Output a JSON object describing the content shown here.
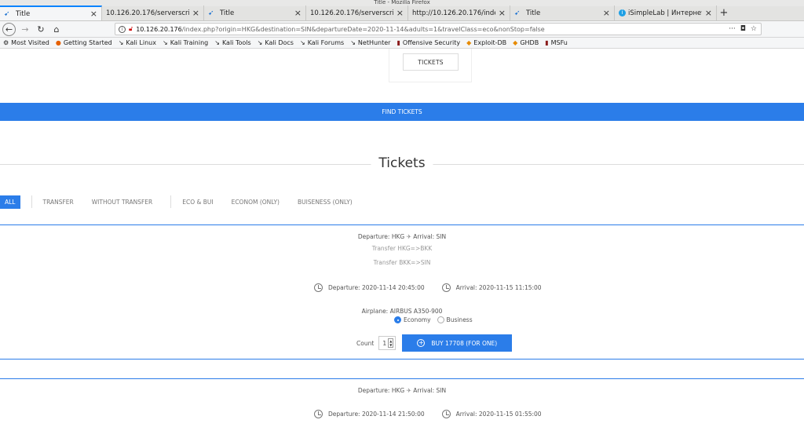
{
  "window": {
    "title": "Title - Mozilla Firefox"
  },
  "tabs": [
    {
      "label": "Title",
      "icon": "bird-icon",
      "active": true
    },
    {
      "label": "10.126.20.176/serverscript",
      "icon": "",
      "active": false
    },
    {
      "label": "Title",
      "icon": "bird-icon",
      "active": false
    },
    {
      "label": "10.126.20.176/serverscript",
      "icon": "",
      "active": false
    },
    {
      "label": "http://10.126.20.176/index.p",
      "icon": "",
      "active": false
    },
    {
      "label": "Title",
      "icon": "bird-icon",
      "active": false
    },
    {
      "label": "iSimpleLab | Интернет-",
      "icon": "info-icon",
      "active": false
    }
  ],
  "urlbar": {
    "host": "10.126.20.176",
    "path": "/index.php?origin=HKG&destination=SIN&departureDate=2020-11-14&adults=1&travelClass=eco&nonStop=false",
    "more": "···"
  },
  "bookmarks": [
    {
      "label": "Most Visited",
      "icon": "gear-icon"
    },
    {
      "label": "Getting Started",
      "icon": "firefox-icon"
    },
    {
      "label": "Kali Linux",
      "icon": "kali-icon"
    },
    {
      "label": "Kali Training",
      "icon": "kali-icon"
    },
    {
      "label": "Kali Tools",
      "icon": "kali-icon"
    },
    {
      "label": "Kali Docs",
      "icon": "kali-icon"
    },
    {
      "label": "Kali Forums",
      "icon": "kali-icon"
    },
    {
      "label": "NetHunter",
      "icon": "kali-icon"
    },
    {
      "label": "Offensive Security",
      "icon": "offsec-icon"
    },
    {
      "label": "Exploit-DB",
      "icon": "exploitdb-icon"
    },
    {
      "label": "GHDB",
      "icon": "exploitdb-icon"
    },
    {
      "label": "MSFu",
      "icon": "offsec-icon"
    }
  ],
  "page": {
    "nav_tickets": "TICKETS",
    "find_tickets": "FIND TICKETS",
    "section_title": "Tickets",
    "filters": [
      "ALL",
      "TRANSFER",
      "WITHOUT TRANSFER",
      "ECO & BUI",
      "ECONOM (ONLY)",
      "BUISENESS (ONLY)"
    ],
    "accent_color": "#2b7de9"
  },
  "tickets": [
    {
      "route": "Departure: HKG",
      "arrival": "Arrival: SIN",
      "transfers": [
        "Transfer HKG=>BKK",
        "Transfer BKK=>SIN"
      ],
      "departure": "Departure: 2020-11-14 20:45:00",
      "arrival_time": "Arrival: 2020-11-15 11:15:00",
      "airplane": "Airplane: AIRBUS A350-900",
      "class_economy": "Economy",
      "class_business": "Business",
      "count_label": "Count",
      "count": "1",
      "buy_label": "BUY 17708 (FOR ONE)"
    },
    {
      "route": "Departure: HKG",
      "arrival": "Arrival: SIN",
      "departure": "Departure: 2020-11-14 21:50:00",
      "arrival_time": "Arrival: 2020-11-15 01:55:00"
    }
  ]
}
